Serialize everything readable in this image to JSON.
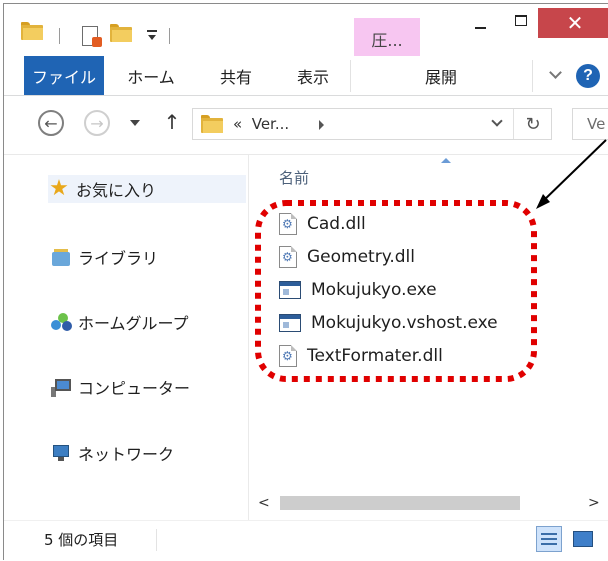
{
  "window": {
    "context_tab": "圧...",
    "close_glyph": "✕"
  },
  "ribbon": {
    "tabs": [
      {
        "label": "ファイル"
      },
      {
        "label": "ホーム"
      },
      {
        "label": "共有"
      },
      {
        "label": "表示"
      },
      {
        "label": "展開"
      }
    ],
    "help_glyph": "?"
  },
  "address": {
    "prefix": "«",
    "path": "Ver...",
    "search_placeholder": "Ve"
  },
  "nav": {
    "items": [
      {
        "label": "お気に入り",
        "icon": "star-icon"
      },
      {
        "label": "ライブラリ",
        "icon": "library-icon"
      },
      {
        "label": "ホームグループ",
        "icon": "homegroup-icon"
      },
      {
        "label": "コンピューター",
        "icon": "computer-icon"
      },
      {
        "label": "ネットワーク",
        "icon": "network-icon"
      }
    ]
  },
  "files": {
    "column_name": "名前",
    "items": [
      {
        "name": "Cad.dll",
        "icon": "dll-file-icon"
      },
      {
        "name": "Geometry.dll",
        "icon": "dll-file-icon"
      },
      {
        "name": "Mokujukyo.exe",
        "icon": "exe-file-icon"
      },
      {
        "name": "Mokujukyo.vshost.exe",
        "icon": "exe-file-icon"
      },
      {
        "name": "TextFormater.dll",
        "icon": "dll-file-icon"
      }
    ]
  },
  "status": {
    "item_count": "5 個の項目"
  },
  "colors": {
    "file_tab": "#1f64b4",
    "context_tab": "#f7c6f1",
    "close_button": "#c7464b",
    "annotation": "#e00000"
  }
}
